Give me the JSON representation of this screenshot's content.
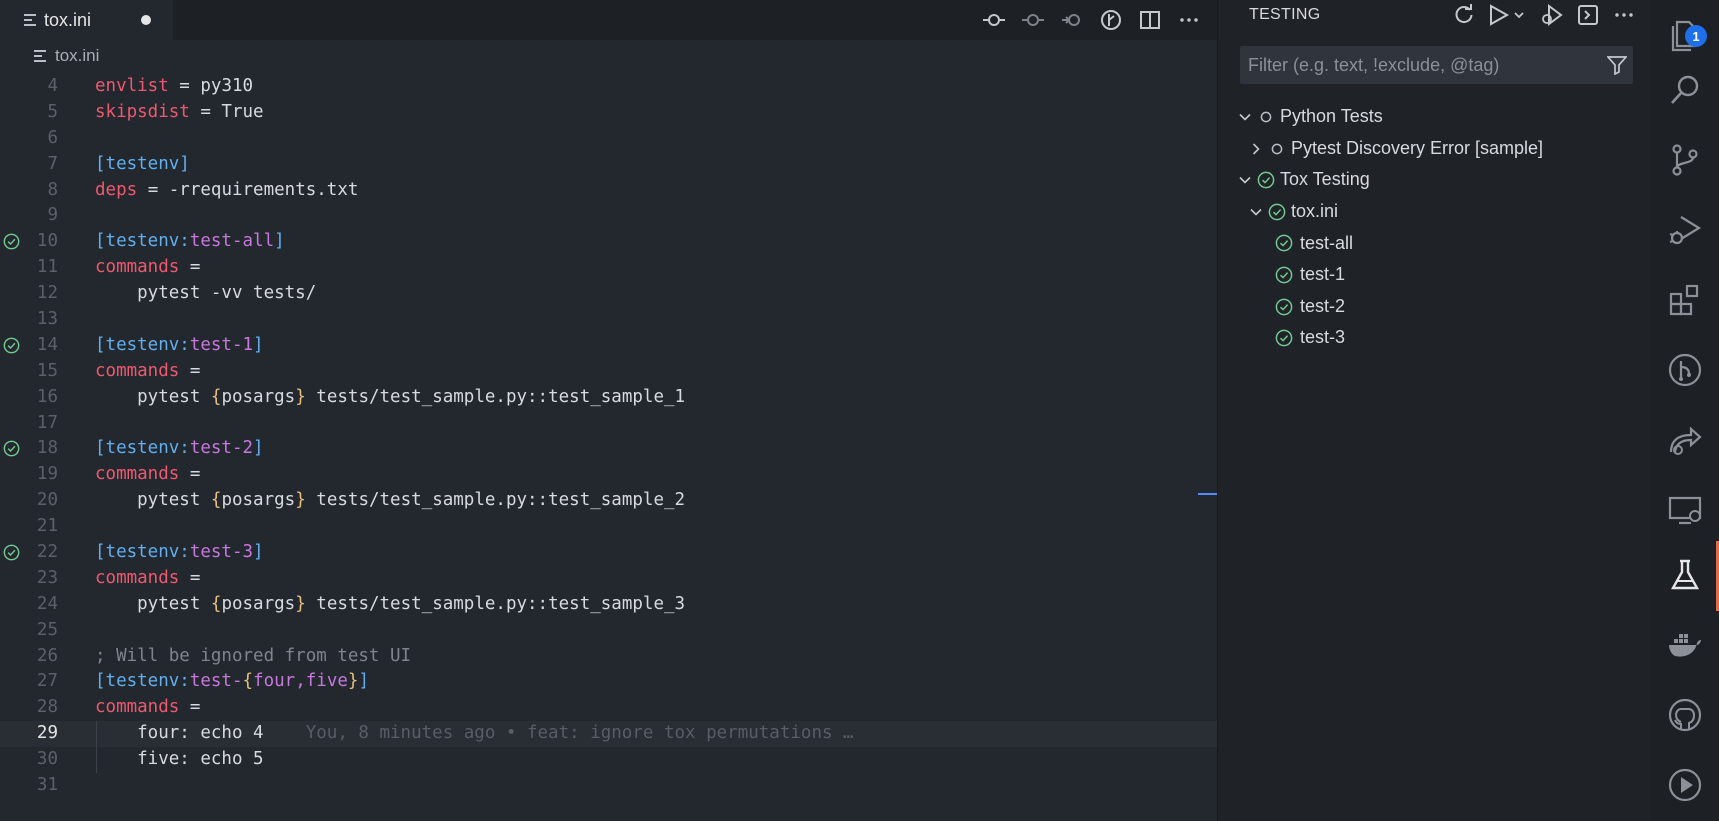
{
  "editor": {
    "tab": {
      "label": "tox.ini",
      "modified": true
    },
    "breadcrumb": "tox.ini",
    "actions": [
      "git-commit-icon",
      "go-back-icon",
      "go-forward-icon",
      "timeline-icon",
      "split-editor-icon",
      "more-actions-icon"
    ],
    "lines": [
      {
        "n": "4",
        "tokens": [
          [
            "key",
            "envlist"
          ],
          [
            "plain",
            " = py310"
          ]
        ]
      },
      {
        "n": "5",
        "tokens": [
          [
            "key",
            "skipsdist"
          ],
          [
            "plain",
            " = True"
          ]
        ]
      },
      {
        "n": "6",
        "tokens": []
      },
      {
        "n": "7",
        "tokens": [
          [
            "sec",
            "[testenv]"
          ]
        ]
      },
      {
        "n": "8",
        "tokens": [
          [
            "key",
            "deps"
          ],
          [
            "plain",
            " = -rrequirements.txt"
          ]
        ]
      },
      {
        "n": "9",
        "tokens": []
      },
      {
        "n": "10",
        "passed": true,
        "tokens": [
          [
            "sec",
            "[testenv:"
          ],
          [
            "sect",
            "test-all"
          ],
          [
            "sec",
            "]"
          ]
        ]
      },
      {
        "n": "11",
        "tokens": [
          [
            "key",
            "commands"
          ],
          [
            "plain",
            " ="
          ]
        ]
      },
      {
        "n": "12",
        "tokens": [
          [
            "plain",
            "    pytest -vv tests/"
          ]
        ]
      },
      {
        "n": "13",
        "tokens": []
      },
      {
        "n": "14",
        "passed": true,
        "tokens": [
          [
            "sec",
            "[testenv:"
          ],
          [
            "sect",
            "test-1"
          ],
          [
            "sec",
            "]"
          ]
        ]
      },
      {
        "n": "15",
        "tokens": [
          [
            "key",
            "commands"
          ],
          [
            "plain",
            " ="
          ]
        ]
      },
      {
        "n": "16",
        "tokens": [
          [
            "plain",
            "    pytest "
          ],
          [
            "brace",
            "{"
          ],
          [
            "plain",
            "posargs"
          ],
          [
            "brace",
            "}"
          ],
          [
            "plain",
            " tests/test_sample.py::test_sample_1"
          ]
        ]
      },
      {
        "n": "17",
        "tokens": []
      },
      {
        "n": "18",
        "passed": true,
        "tokens": [
          [
            "sec",
            "[testenv:"
          ],
          [
            "sect",
            "test-2"
          ],
          [
            "sec",
            "]"
          ]
        ]
      },
      {
        "n": "19",
        "tokens": [
          [
            "key",
            "commands"
          ],
          [
            "plain",
            " ="
          ]
        ]
      },
      {
        "n": "20",
        "tokens": [
          [
            "plain",
            "    pytest "
          ],
          [
            "brace",
            "{"
          ],
          [
            "plain",
            "posargs"
          ],
          [
            "brace",
            "}"
          ],
          [
            "plain",
            " tests/test_sample.py::test_sample_2"
          ]
        ]
      },
      {
        "n": "21",
        "tokens": []
      },
      {
        "n": "22",
        "passed": true,
        "tokens": [
          [
            "sec",
            "[testenv:"
          ],
          [
            "sect",
            "test-3"
          ],
          [
            "sec",
            "]"
          ]
        ]
      },
      {
        "n": "23",
        "tokens": [
          [
            "key",
            "commands"
          ],
          [
            "plain",
            " ="
          ]
        ]
      },
      {
        "n": "24",
        "tokens": [
          [
            "plain",
            "    pytest "
          ],
          [
            "brace",
            "{"
          ],
          [
            "plain",
            "posargs"
          ],
          [
            "brace",
            "}"
          ],
          [
            "plain",
            " tests/test_sample.py::test_sample_3"
          ]
        ]
      },
      {
        "n": "25",
        "tokens": []
      },
      {
        "n": "26",
        "tokens": [
          [
            "comment",
            "; Will be ignored from test UI"
          ]
        ]
      },
      {
        "n": "27",
        "tokens": [
          [
            "sec",
            "[testenv:"
          ],
          [
            "sect",
            "test-"
          ],
          [
            "brace",
            "{"
          ],
          [
            "sect",
            "four,five"
          ],
          [
            "brace",
            "}"
          ],
          [
            "sec",
            "]"
          ]
        ]
      },
      {
        "n": "28",
        "tokens": [
          [
            "key",
            "commands"
          ],
          [
            "plain",
            " ="
          ]
        ]
      },
      {
        "n": "29",
        "current": true,
        "guide": true,
        "tokens": [
          [
            "plain",
            "    four: echo 4"
          ],
          [
            "blame",
            "    You, 8 minutes ago • feat: ignore tox permutations …"
          ]
        ]
      },
      {
        "n": "30",
        "guide": true,
        "tokens": [
          [
            "plain",
            "    five: echo 5"
          ]
        ]
      },
      {
        "n": "31",
        "tokens": []
      }
    ]
  },
  "testing": {
    "title": "TESTING",
    "actions": [
      "refresh-tests-icon",
      "run-all-tests-icon",
      "run-dropdown-icon",
      "debug-all-tests-icon",
      "show-output-icon",
      "more-actions-icon"
    ],
    "filter_placeholder": "Filter (e.g. text, !exclude, @tag)",
    "filter_value": "",
    "tree": [
      {
        "label": "Python Tests",
        "depth": 0,
        "chevron": "down",
        "status": "unset"
      },
      {
        "label": "Pytest Discovery Error [sample]",
        "depth": 1,
        "chevron": "right",
        "status": "unset"
      },
      {
        "label": "Tox Testing",
        "depth": 0,
        "chevron": "down",
        "status": "passed"
      },
      {
        "label": "tox.ini",
        "depth": 1,
        "chevron": "down",
        "status": "passed"
      },
      {
        "label": "test-all",
        "depth": 2,
        "chevron": "none",
        "status": "passed"
      },
      {
        "label": "test-1",
        "depth": 2,
        "chevron": "none",
        "status": "passed"
      },
      {
        "label": "test-2",
        "depth": 2,
        "chevron": "none",
        "status": "passed"
      },
      {
        "label": "test-3",
        "depth": 2,
        "chevron": "none",
        "status": "passed"
      }
    ]
  },
  "activity_bar": {
    "explorer_badge": "1",
    "items": [
      "explorer-icon",
      "search-icon",
      "source-control-icon",
      "run-debug-icon",
      "extensions-icon",
      "git-graph-icon",
      "live-share-icon",
      "remote-explorer-icon",
      "testing-icon",
      "docker-icon",
      "github-icon",
      "play-icon"
    ],
    "active": "testing-icon"
  },
  "colors": {
    "pass": "#73c991",
    "key": "#ef596f",
    "section": "#61afef",
    "section_name": "#c678dd",
    "brace": "#e5c07b",
    "accent": "#1f6feb"
  }
}
